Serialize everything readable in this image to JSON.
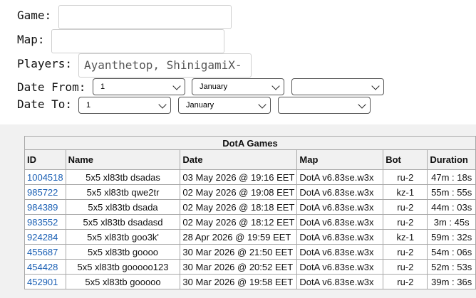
{
  "form": {
    "game_label": "Game:",
    "game_value": "",
    "map_label": "Map:",
    "map_value": "",
    "players_label": "Players:",
    "players_value": "Ayanthetop, ShinigamiX-",
    "date_from_label": "Date From:",
    "date_to_label": "Date To:",
    "date_from": {
      "day": "1",
      "month": "January",
      "year": ""
    },
    "date_to": {
      "day": "1",
      "month": "January",
      "year": ""
    }
  },
  "table": {
    "caption": "DotA Games",
    "columns": [
      "ID",
      "Name",
      "Date",
      "Map",
      "Bot",
      "Duration"
    ],
    "rows": [
      [
        "1004518",
        "5x5 xl83tb dsadas",
        "03 May 2026 @ 19:16 EET",
        "DotA v6.83se.w3x",
        "ru-2",
        "47m : 18s"
      ],
      [
        "985722",
        "5x5 xl83tb qwe2tr",
        "02 May 2026 @ 19:08 EET",
        "DotA v6.83se.w3x",
        "kz-1",
        "55m : 55s"
      ],
      [
        "984389",
        "5x5 xl83tb dsada",
        "02 May 2026 @ 18:18 EET",
        "DotA v6.83se.w3x",
        "ru-2",
        "44m : 03s"
      ],
      [
        "983552",
        "5x5 xl83tb dsadasd",
        "02 May 2026 @ 18:12 EET",
        "DotA v6.83se.w3x",
        "ru-2",
        "3m : 45s"
      ],
      [
        "924284",
        "5x5 xl83tb goo3k'",
        "28 Apr 2026 @ 19:59 EET",
        "DotA v6.83se.w3x",
        "kz-1",
        "59m : 32s"
      ],
      [
        "455687",
        "5x5 xl83tb goooo",
        "30 Mar 2026 @ 21:50 EET",
        "DotA v6.83se.w3x",
        "ru-2",
        "54m : 06s"
      ],
      [
        "454428",
        "5x5 xl83tb gooooo123",
        "30 Mar 2026 @ 20:52 EET",
        "DotA v6.83se.w3x",
        "ru-2",
        "52m : 53s"
      ],
      [
        "452901",
        "5x5 xl83tb gooooo",
        "30 Mar 2026 @ 19:58 EET",
        "DotA v6.83se.w3x",
        "ru-2",
        "39m : 36s"
      ]
    ]
  }
}
